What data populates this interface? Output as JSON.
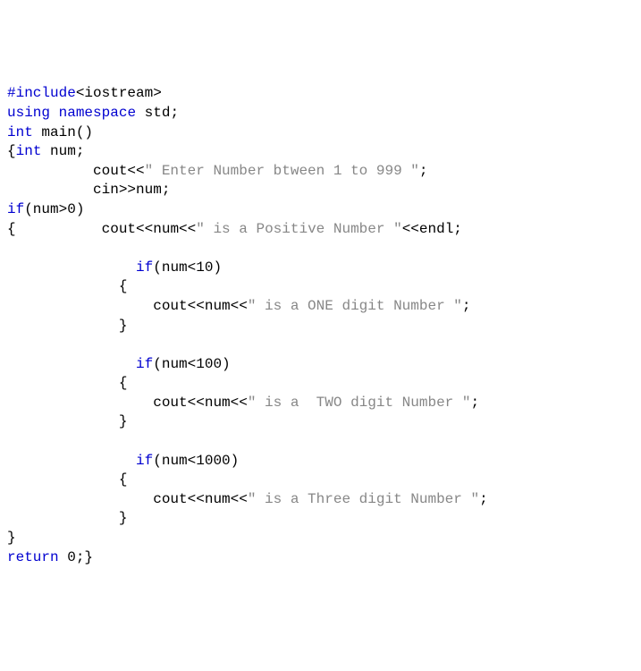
{
  "code": {
    "kw_include": "#include",
    "hdr": "<iostream>",
    "kw_using": "using",
    "kw_namespace": "namespace",
    "std": " std;",
    "kw_int1": "int",
    "main_decl": " main()",
    "brace_open_int": "{",
    "kw_int2": "int",
    "num_decl": " num;",
    "cout1a": "          cout<<",
    "str1": "\" Enter Number btween 1 to 999 \"",
    "cout1b": ";",
    "cin_line": "          cin>>num;",
    "kw_if1": "if",
    "cond1": "(num>0)",
    "brace_pos_open": "{",
    "cout2a": "          cout<<num<<",
    "str2": "\" is a Positive Number \"",
    "cout2b": "<<endl;",
    "blank": "",
    "if2_pad": "               ",
    "kw_if2": "if",
    "cond2": "(num<10)",
    "brace2_open": "             {",
    "cout3a": "                 cout<<num<<",
    "str3": "\" is a ONE digit Number \"",
    "cout3b": ";",
    "brace2_close": "             }",
    "if3_pad": "               ",
    "kw_if3": "if",
    "cond3": "(num<100)",
    "brace3_open": "             {",
    "cout4a": "                 cout<<num<<",
    "str4": "\" is a  TWO digit Number \"",
    "cout4b": ";",
    "brace3_close": "             }",
    "if4_pad": "               ",
    "kw_if4": "if",
    "cond4": "(num<1000)",
    "brace4_open": "             {",
    "cout5a": "                 cout<<num<<",
    "str5": "\" is a Three digit Number \"",
    "cout5b": ";",
    "brace4_close": "             }",
    "brace_pos_close": "}",
    "kw_return": "return",
    "return_tail": " 0;}"
  }
}
